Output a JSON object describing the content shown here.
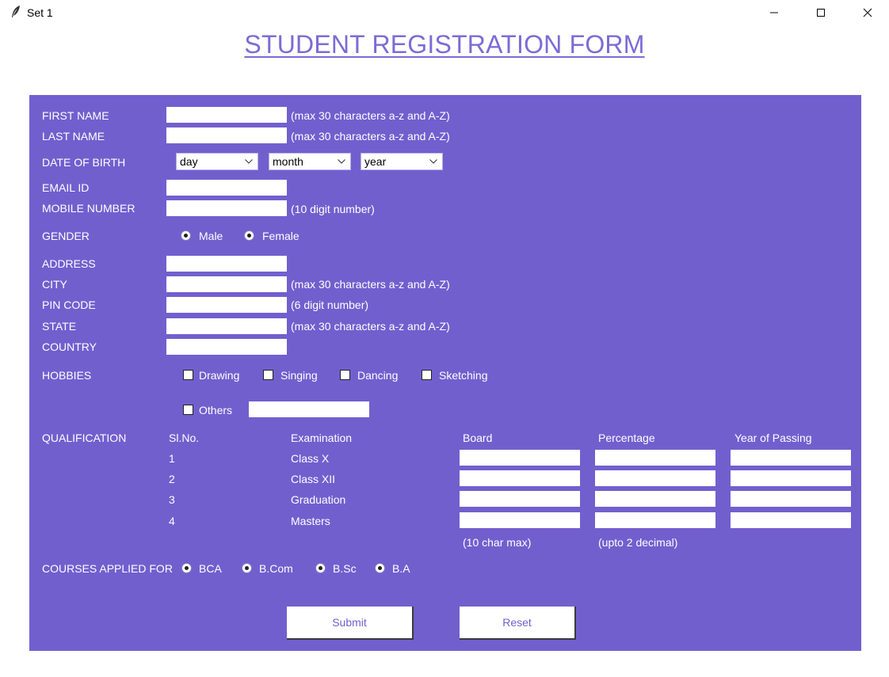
{
  "window": {
    "title": "Set 1",
    "icon": "feather-icon"
  },
  "form_title": "STUDENT REGISTRATION FORM",
  "personal": {
    "first_name": {
      "label": "FIRST NAME",
      "value": "",
      "hint": "(max 30 characters a-z and A-Z)"
    },
    "last_name": {
      "label": "LAST NAME",
      "value": "",
      "hint": "(max 30 characters a-z and A-Z)"
    },
    "dob": {
      "label": "DATE OF BIRTH",
      "day": "day",
      "month": "month",
      "year": "year"
    },
    "email": {
      "label": "EMAIL ID",
      "value": ""
    },
    "mobile": {
      "label": "MOBILE NUMBER",
      "value": "",
      "hint": "(10 digit number)"
    },
    "gender": {
      "label": "GENDER",
      "options": [
        "Male",
        "Female"
      ]
    }
  },
  "address": {
    "address": {
      "label": "ADDRESS",
      "value": ""
    },
    "city": {
      "label": "CITY",
      "value": "",
      "hint": "(max 30 characters a-z and A-Z)"
    },
    "pin": {
      "label": "PIN CODE",
      "value": "",
      "hint": "(6 digit number)"
    },
    "state": {
      "label": "STATE",
      "value": "",
      "hint": "(max 30 characters a-z and A-Z)"
    },
    "country": {
      "label": "COUNTRY",
      "value": ""
    }
  },
  "hobbies": {
    "label": "HOBBIES",
    "options": [
      "Drawing",
      "Singing",
      "Dancing",
      "Sketching"
    ],
    "others": "Others",
    "others_value": ""
  },
  "qualification": {
    "label": "QUALIFICATION",
    "headers": [
      "Sl.No.",
      "Examination",
      "Board",
      "Percentage",
      "Year of Passing"
    ],
    "rows": [
      {
        "sno": "1",
        "exam": "Class X"
      },
      {
        "sno": "2",
        "exam": "Class XII"
      },
      {
        "sno": "3",
        "exam": "Graduation"
      },
      {
        "sno": "4",
        "exam": "Masters"
      }
    ],
    "board_hint": "(10 char max)",
    "percentage_hint": "(upto 2 decimal)"
  },
  "courses": {
    "label": "COURSES APPLIED FOR",
    "options": [
      "BCA",
      "B.Com",
      "B.Sc",
      "B.A"
    ]
  },
  "buttons": {
    "submit": "Submit",
    "reset": "Reset"
  },
  "colors": {
    "panel": "#725fce",
    "title": "#7b6cd6",
    "text": "#ffffff"
  }
}
